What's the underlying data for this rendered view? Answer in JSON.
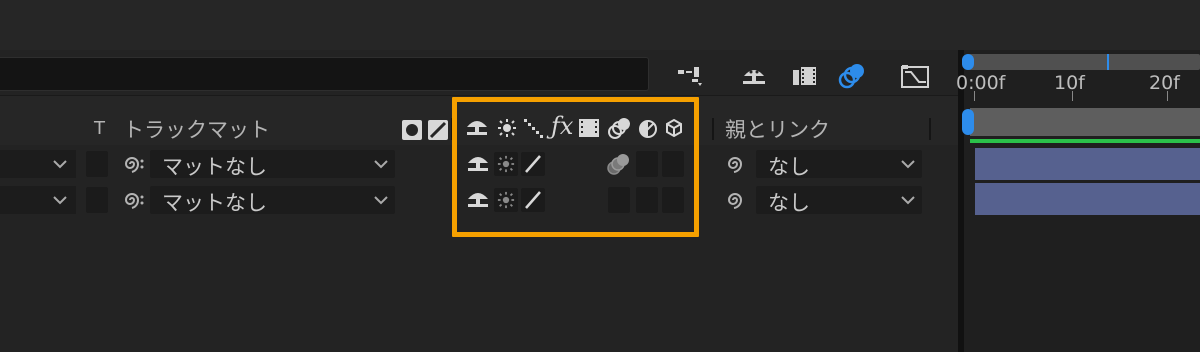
{
  "header": {
    "t_label": "T",
    "trackmatte_label": "トラックマット",
    "parent_label": "親とリンク"
  },
  "layers": [
    {
      "matte_value": "マットなし",
      "parent_value": "なし"
    },
    {
      "matte_value": "マットなし",
      "parent_value": "なし"
    }
  ],
  "timeline": {
    "ruler_labels": [
      "0:00f",
      "10f",
      "20f"
    ]
  },
  "colors": {
    "highlight": "#f5a000",
    "accent_blue": "#2d8ceb",
    "layer_bar": "#56618f",
    "work_area_green": "#2bc14a"
  }
}
